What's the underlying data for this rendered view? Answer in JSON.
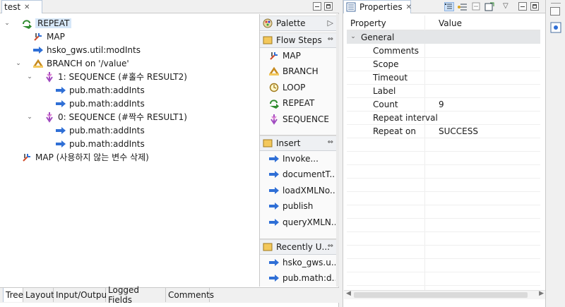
{
  "editor": {
    "tab_title": "test",
    "tree": [
      {
        "label": "REPEAT",
        "icon": "repeat-icon",
        "depth": 0,
        "twisty": "expanded",
        "selected": true
      },
      {
        "label": "MAP",
        "icon": "map-icon",
        "depth": 1,
        "twisty": "none"
      },
      {
        "label": "hsko_gws.util:modInts",
        "icon": "invoke-icon",
        "depth": 1,
        "twisty": "none"
      },
      {
        "label": "BRANCH on '/value'",
        "icon": "branch-icon",
        "depth": 1,
        "twisty": "expanded"
      },
      {
        "label": "1: SEQUENCE (#홀수 RESULT2)",
        "icon": "sequence-icon",
        "depth": 2,
        "twisty": "expanded"
      },
      {
        "label": "pub.math:addInts",
        "icon": "invoke-icon",
        "depth": 3,
        "twisty": "none"
      },
      {
        "label": "pub.math:addInts",
        "icon": "invoke-icon",
        "depth": 3,
        "twisty": "none"
      },
      {
        "label": "0: SEQUENCE (#짝수 RESULT1)",
        "icon": "sequence-icon",
        "depth": 2,
        "twisty": "expanded"
      },
      {
        "label": "pub.math:addInts",
        "icon": "invoke-icon",
        "depth": 3,
        "twisty": "none"
      },
      {
        "label": "pub.math:addInts",
        "icon": "invoke-icon",
        "depth": 3,
        "twisty": "none"
      },
      {
        "label": "MAP (사용하지 않는 변수 삭제)",
        "icon": "map-icon",
        "depth": 0,
        "twisty": "none"
      }
    ],
    "bottom_tabs": [
      "Tree",
      "Layout",
      "Input/Output",
      "Logged Fields",
      "Comments"
    ]
  },
  "palette": {
    "title": "Palette",
    "flow_steps": {
      "title": "Flow Steps",
      "items": [
        {
          "label": "MAP",
          "icon": "map-icon"
        },
        {
          "label": "BRANCH",
          "icon": "branch-icon"
        },
        {
          "label": "LOOP",
          "icon": "loop-icon"
        },
        {
          "label": "REPEAT",
          "icon": "repeat-icon"
        },
        {
          "label": "SEQUENCE",
          "icon": "sequence-icon"
        }
      ]
    },
    "insert": {
      "title": "Insert",
      "items": [
        {
          "label": "Invoke...",
          "icon": "invoke-icon"
        },
        {
          "label": "documentT...",
          "icon": "invoke-icon"
        },
        {
          "label": "loadXMLNo...",
          "icon": "invoke-icon"
        },
        {
          "label": "publish",
          "icon": "invoke-icon"
        },
        {
          "label": "queryXMLN...",
          "icon": "invoke-icon"
        }
      ]
    },
    "recent": {
      "title": "Recently U...",
      "items": [
        {
          "label": "hsko_gws.u...",
          "icon": "invoke-icon"
        },
        {
          "label": "pub.math:d...",
          "icon": "invoke-icon"
        }
      ]
    }
  },
  "properties": {
    "tab_title": "Properties",
    "header": {
      "property": "Property",
      "value": "Value"
    },
    "group": "General",
    "rows": [
      {
        "property": "Comments",
        "value": ""
      },
      {
        "property": "Scope",
        "value": ""
      },
      {
        "property": "Timeout",
        "value": ""
      },
      {
        "property": "Label",
        "value": ""
      },
      {
        "property": "Count",
        "value": "9"
      },
      {
        "property": "Repeat interval",
        "value": ""
      },
      {
        "property": "Repeat on",
        "value": "SUCCESS"
      }
    ]
  },
  "colors": {
    "invoke": "#2f6fd6",
    "repeat": "#2f8c2f",
    "sequence": "#a04ac0",
    "branch": "#c68a1f",
    "selection": "#d6e7f8"
  }
}
